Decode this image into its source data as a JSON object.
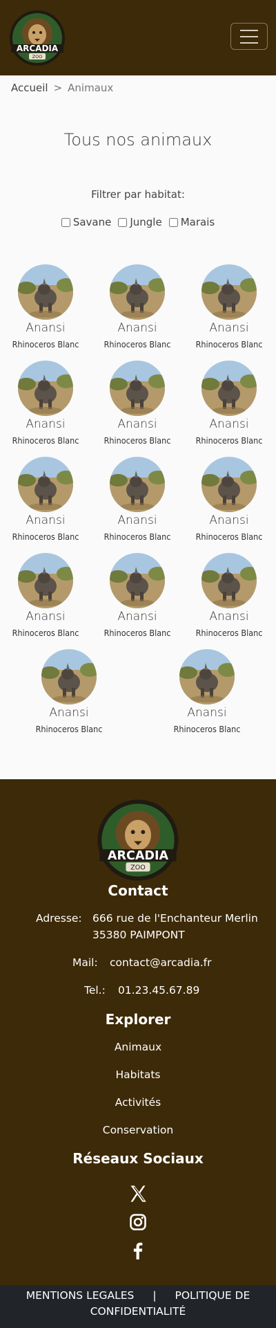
{
  "header": {
    "logo_text": "ARCADIA",
    "logo_sub": "ZOO"
  },
  "breadcrumb": {
    "home": "Accueil",
    "separator": ">",
    "current": "Animaux"
  },
  "page": {
    "title": "Tous nos animaux",
    "filter_label": "Filtrer par habitat:"
  },
  "filters": [
    {
      "label": "Savane",
      "checked": false
    },
    {
      "label": "Jungle",
      "checked": false
    },
    {
      "label": "Marais",
      "checked": false
    }
  ],
  "animals": [
    {
      "name": "Anansi",
      "species": "Rhinoceros Blanc"
    },
    {
      "name": "Anansi",
      "species": "Rhinoceros Blanc"
    },
    {
      "name": "Anansi",
      "species": "Rhinoceros Blanc"
    },
    {
      "name": "Anansi",
      "species": "Rhinoceros Blanc"
    },
    {
      "name": "Anansi",
      "species": "Rhinoceros Blanc"
    },
    {
      "name": "Anansi",
      "species": "Rhinoceros Blanc"
    },
    {
      "name": "Anansi",
      "species": "Rhinoceros Blanc"
    },
    {
      "name": "Anansi",
      "species": "Rhinoceros Blanc"
    },
    {
      "name": "Anansi",
      "species": "Rhinoceros Blanc"
    },
    {
      "name": "Anansi",
      "species": "Rhinoceros Blanc"
    },
    {
      "name": "Anansi",
      "species": "Rhinoceros Blanc"
    },
    {
      "name": "Anansi",
      "species": "Rhinoceros Blanc"
    },
    {
      "name": "Anansi",
      "species": "Rhinoceros Blanc"
    },
    {
      "name": "Anansi",
      "species": "Rhinoceros Blanc"
    }
  ],
  "footer": {
    "contact_title": "Contact",
    "address_label": "Adresse:",
    "address_line1": "666 rue de l'Enchanteur Merlin",
    "address_line2": "35380 PAIMPONT",
    "mail_label": "Mail:",
    "mail": "contact@arcadia.fr",
    "tel_label": "Tel.:",
    "tel": "01.23.45.67.89",
    "explore_title": "Explorer",
    "explore_links": [
      "Animaux",
      "Habitats",
      "Activités",
      "Conservation"
    ],
    "social_title": "Réseaux Sociaux",
    "social_icons": [
      "x-icon",
      "instagram-icon",
      "facebook-icon"
    ]
  },
  "bottom_bar": {
    "legal": "MENTIONS LEGALES",
    "divider": "|",
    "privacy_line1": "POLITIQUE DE",
    "privacy_line2": "CONFIDENTIALITÉ"
  },
  "colors": {
    "brand_brown": "#3d2a08",
    "bottom_bar": "#212529"
  }
}
